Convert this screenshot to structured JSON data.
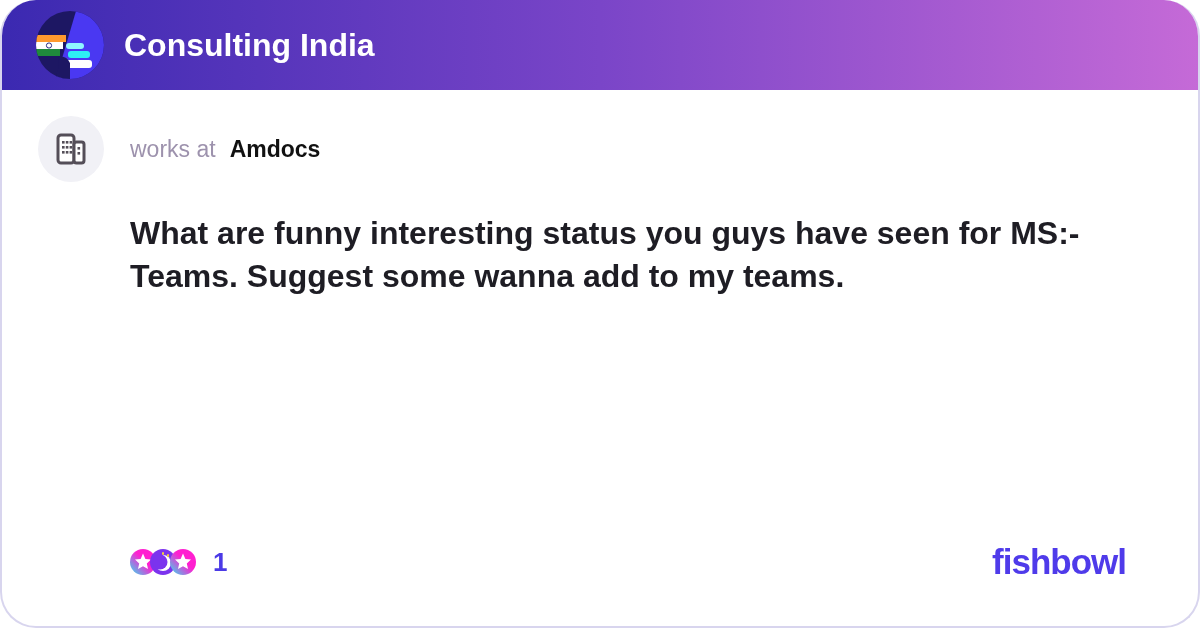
{
  "header": {
    "title": "Consulting India"
  },
  "post": {
    "author": {
      "label": "works at",
      "company": "Amdocs"
    },
    "question": "What are funny interesting status you guys have seen for MS:- Teams. Suggest some wanna add to my teams."
  },
  "footer": {
    "reactions": {
      "count": "1"
    },
    "brand": "fishbowl"
  }
}
